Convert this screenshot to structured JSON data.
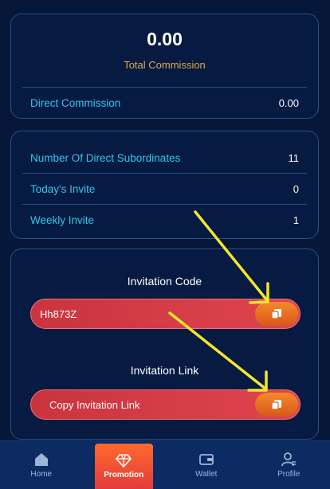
{
  "total": {
    "amount": "0.00",
    "label": "Total Commission",
    "direct_label": "Direct Commission",
    "direct_value": "0.00"
  },
  "stats": [
    {
      "label": "Number Of Direct Subordinates",
      "value": "11"
    },
    {
      "label": "Today's Invite",
      "value": "0"
    },
    {
      "label": "Weekly Invite",
      "value": "1"
    }
  ],
  "invite": {
    "code_title": "Invitation Code",
    "code_value": "Hh873Z",
    "link_title": "Invitation Link",
    "link_button": "Copy Invitation Link"
  },
  "nav": {
    "items": [
      {
        "label": "Home",
        "icon": "home-icon"
      },
      {
        "label": "Promotion",
        "icon": "diamond-icon",
        "active": true
      },
      {
        "label": "Wallet",
        "icon": "wallet-icon"
      },
      {
        "label": "Profile",
        "icon": "profile-icon"
      }
    ]
  },
  "colors": {
    "background": "#06173a",
    "accent_cyan": "#33c7ea",
    "accent_gold": "#e1a94a",
    "pill_red": "#d93d47",
    "copy_orange": "#f07a26",
    "annotation_arrow": "#f6e62b"
  }
}
